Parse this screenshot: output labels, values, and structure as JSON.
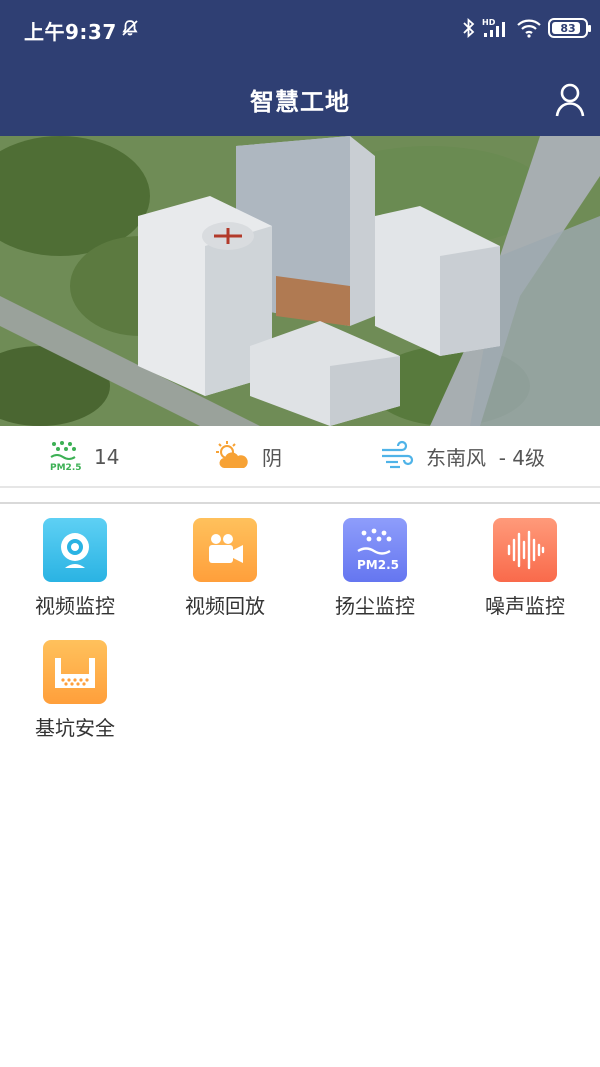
{
  "status": {
    "time": "上午9:37",
    "battery": "83"
  },
  "header": {
    "title": "智慧工地"
  },
  "weather": {
    "pm25_icon_text": "PM2.5",
    "pm25_value": "14",
    "condition": "阴",
    "wind": "东南风  - 4级"
  },
  "menu": [
    {
      "label": "视频监控",
      "icon": "webcam-icon",
      "color_from": "#5ed0f4",
      "color_to": "#2ab3e3"
    },
    {
      "label": "视频回放",
      "icon": "video-camera-icon",
      "color_from": "#ffc15c",
      "color_to": "#ff9f3b"
    },
    {
      "label": "扬尘监控",
      "icon": "pm25-dust-icon",
      "color_from": "#8e9dfb",
      "color_to": "#6576f0",
      "icon_text": "PM2.5"
    },
    {
      "label": "噪声监控",
      "icon": "sound-wave-icon",
      "color_from": "#ff9a7a",
      "color_to": "#f96a4b"
    },
    {
      "label": "基坑安全",
      "icon": "foundation-pit-icon",
      "color_from": "#ffc15c",
      "color_to": "#ff9f3b"
    }
  ],
  "colors": {
    "header_bg": "#2f3f73"
  }
}
